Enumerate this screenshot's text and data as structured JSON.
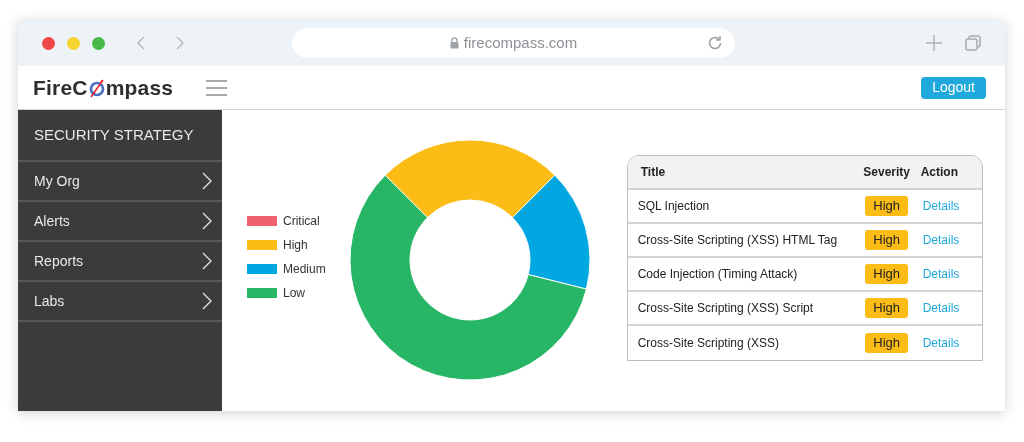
{
  "browser": {
    "url": "firecompass.com"
  },
  "header": {
    "logo": {
      "before": "FireC",
      "after": "mpass"
    },
    "logout": "Logout"
  },
  "sidebar": {
    "title": "SECURITY STRATEGY",
    "items": [
      {
        "label": "My Org"
      },
      {
        "label": "Alerts"
      },
      {
        "label": "Reports"
      },
      {
        "label": "Labs"
      }
    ]
  },
  "legend": [
    {
      "label": "Critical",
      "color": "#f0606e"
    },
    {
      "label": "High",
      "color": "#fbbc16"
    },
    {
      "label": "Medium",
      "color": "#00a7e1"
    },
    {
      "label": "Low",
      "color": "#27b566"
    }
  ],
  "table": {
    "columns": [
      "Title",
      "Severity",
      "Action"
    ],
    "rows": [
      {
        "title": "SQL Injection",
        "severity": "High",
        "action": "Details"
      },
      {
        "title": "Cross-Site Scripting (XSS) HTML Tag",
        "severity": "High",
        "action": "Details"
      },
      {
        "title": "Code Injection (Timing Attack)",
        "severity": "High",
        "action": "Details"
      },
      {
        "title": "Cross-Site Scripting (XSS) Script",
        "severity": "High",
        "action": "Details"
      },
      {
        "title": "Cross-Site Scripting (XSS)",
        "severity": "High",
        "action": "Details"
      }
    ]
  }
}
